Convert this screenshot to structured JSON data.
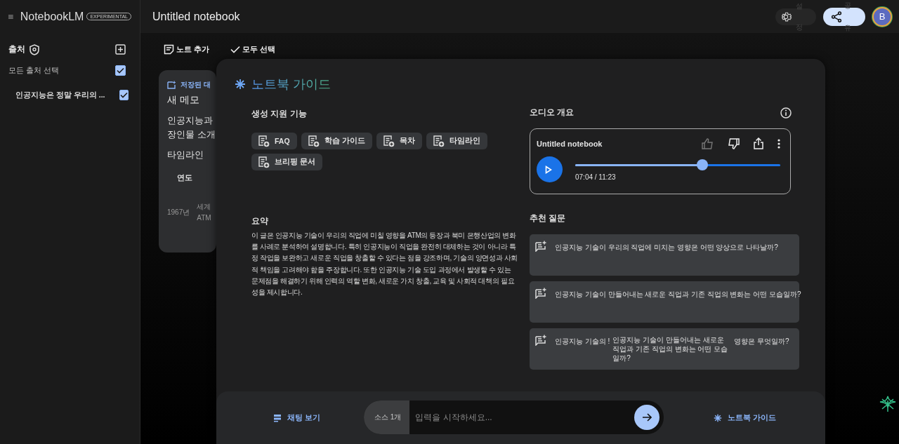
{
  "app": {
    "name": "NotebookLM",
    "badge": "EXPERIMENTAL"
  },
  "notebook_title": "Untitled notebook",
  "header": {
    "settings_tooltip": [
      "설",
      "정"
    ],
    "share_tooltip": [
      "공",
      "유"
    ],
    "avatar": "B"
  },
  "sidebar": {
    "title": "출처",
    "select_all": {
      "label": "모든 출처 선택",
      "checked": true
    },
    "sources": [
      {
        "label": "인공지능은 정말 우리의 ...",
        "checked": true
      }
    ]
  },
  "toolbar": [
    {
      "label": "노트 추가",
      "kind": "add-note"
    },
    {
      "label": "모두 선택",
      "kind": "select-all"
    }
  ],
  "note_card": {
    "header": "저장된 대",
    "title": "새 메모",
    "lines": [
      "인공지능과",
      "장인물 소개"
    ],
    "section": "타임라인",
    "column": "연도",
    "row": {
      "year": "1967년",
      "lines": [
        "세계",
        "ATM"
      ]
    }
  },
  "guide": {
    "title": "노트북 가이드",
    "features_title": "생성 지원 기능",
    "features": [
      "FAQ",
      "학습 가이드",
      "목차",
      "타임라인",
      "브리핑 문서"
    ],
    "summary_title": "요약",
    "summary": "이 글은 인공지능 기술이 우리의 직업에 미칠 영향을 ATM의 등장과 북미 은행산업의 변화를 사례로 분석하여 설명합니다. 특히 인공지능이 직업을 완전히 대체하는 것이 아니라 특정 작업을 보완하고 새로운 직업을 창출할 수 있다는 점을 강조하며, 기술의 양면성과 사회적 책임을 고려해야 함을 주장합니다. 또한 인공지능 기술 도입 과정에서 발생할 수 있는 문제점을 해결하기 위해 인력의 역할 변화, 새로운 가치 창출, 교육 및 사회적 대책의 필요성을 제시합니다.",
    "audio": {
      "title": "오디오 개요",
      "track": "Untitled notebook",
      "level": 0.62,
      "time": "07:04 / 11:23"
    },
    "questions_title": "추천 질문",
    "questions": [
      {
        "text": "인공지능 기술이 우리의 직업에 미치는 영향은 어떤 양상으로 나타날까?"
      },
      {
        "text": "인공지능 기술이 만들어내는 새로운 직업과 기존 직업의 변화는 어떤 모습일까?"
      },
      {
        "text": "인공지능 기술의 !",
        "tooltip": "인공지능 기술이 만들어내는 새로운 직업과 기존 직업의 변화는 어떤 모습일까?",
        "text_after": "영향은 무엇일까?"
      }
    ]
  },
  "chat": {
    "view_chat": "채팅 보기",
    "source_count": "소스 1개",
    "placeholder": "입력을 시작하세요...",
    "guide_button": "노트북 가이드"
  }
}
